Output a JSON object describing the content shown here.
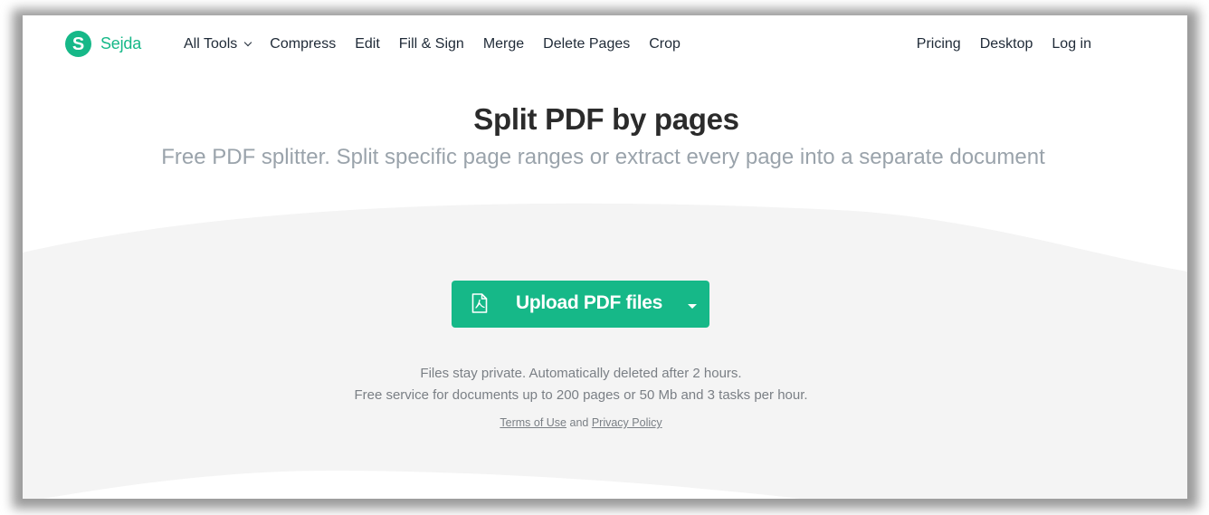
{
  "brand": {
    "name": "Sejda",
    "logo_letter": "S",
    "color": "#16b888"
  },
  "nav": {
    "left_links": [
      {
        "label": "All Tools",
        "has_dropdown": true
      },
      {
        "label": "Compress"
      },
      {
        "label": "Edit"
      },
      {
        "label": "Fill & Sign"
      },
      {
        "label": "Merge"
      },
      {
        "label": "Delete Pages"
      },
      {
        "label": "Crop"
      }
    ],
    "right_links": [
      {
        "label": "Pricing"
      },
      {
        "label": "Desktop"
      },
      {
        "label": "Log in"
      }
    ]
  },
  "hero": {
    "title": "Split PDF by pages",
    "subtitle": "Free PDF splitter. Split specific page ranges or extract every page into a separate document"
  },
  "upload": {
    "label": "Upload PDF files",
    "icon": "pdf-file-icon",
    "dropdown_icon": "caret-down-icon",
    "color": "#16b888"
  },
  "info": {
    "privacy": "Files stay private. Automatically deleted after 2 hours.",
    "limits": "Free service for documents up to 200 pages or 50 Mb and 3 tasks per hour.",
    "terms_label": "Terms of Use",
    "and_label": " and ",
    "privacy_label": "Privacy Policy"
  }
}
